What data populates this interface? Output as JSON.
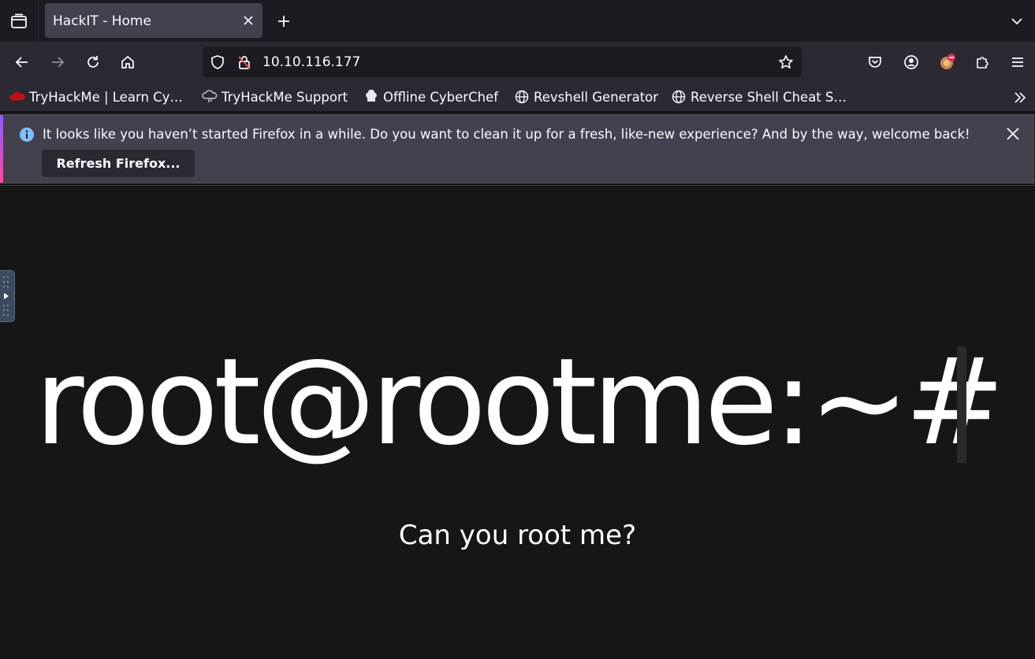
{
  "browser": {
    "tab": {
      "title": "HackIT - Home"
    },
    "url": "10.10.116.177",
    "bookmarks": [
      {
        "label": "TryHackMe | Learn Cy…",
        "icon": "tryhackme-icon"
      },
      {
        "label": "TryHackMe Support",
        "icon": "support-icon"
      },
      {
        "label": "Offline CyberChef",
        "icon": "chef-hat-icon"
      },
      {
        "label": "Revshell Generator",
        "icon": "globe-icon"
      },
      {
        "label": "Reverse Shell Cheat S…",
        "icon": "globe-icon"
      }
    ],
    "notification": {
      "message": "It looks like you haven’t started Firefox in a while. Do you want to clean it up for a fresh, like-new experience? And by the way, welcome back!",
      "button": "Refresh Firefox..."
    }
  },
  "page": {
    "title": "root@rootme:~#",
    "subtitle": "Can you root me?"
  },
  "colors": {
    "accent": "#9059ff",
    "page_background": "#161616",
    "text": "#ffffff"
  }
}
